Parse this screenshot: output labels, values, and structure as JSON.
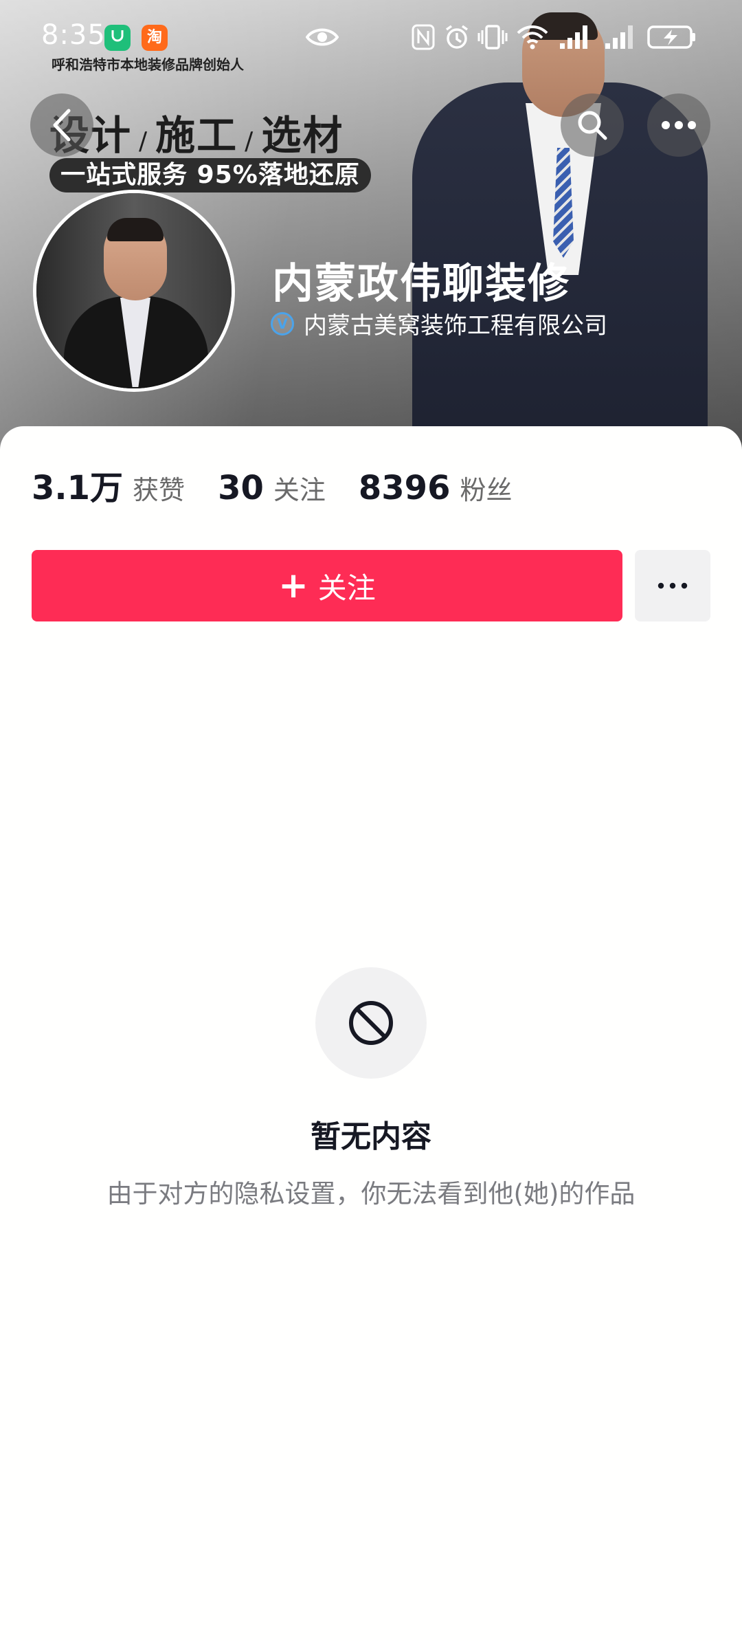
{
  "status_bar": {
    "time": "8:35",
    "app_icons": [
      "mi-home-icon",
      "taobao-icon"
    ],
    "taobao_glyph": "淘",
    "subtitle": "呼和浩特市本地装修品牌创始人"
  },
  "banner": {
    "slogan_parts": [
      "设计",
      "施工",
      "选材"
    ],
    "slogan_separator": "/",
    "pill_text": "一站式服务 95%落地还原"
  },
  "profile": {
    "name": "内蒙政伟聊装修",
    "verified_badge": "V",
    "company": "内蒙古美窝装饰工程有限公司"
  },
  "stats": [
    {
      "num": "3.1万",
      "label": "获赞"
    },
    {
      "num": "30",
      "label": "关注"
    },
    {
      "num": "8396",
      "label": "粉丝"
    }
  ],
  "actions": {
    "follow_plus": "+",
    "follow_label": "关注"
  },
  "empty_state": {
    "title": "暂无内容",
    "description": "由于对方的隐私设置，你无法看到他(她)的作品"
  },
  "colors": {
    "follow_button": "#fe2c55",
    "verified_blue": "#4ba3ea"
  }
}
